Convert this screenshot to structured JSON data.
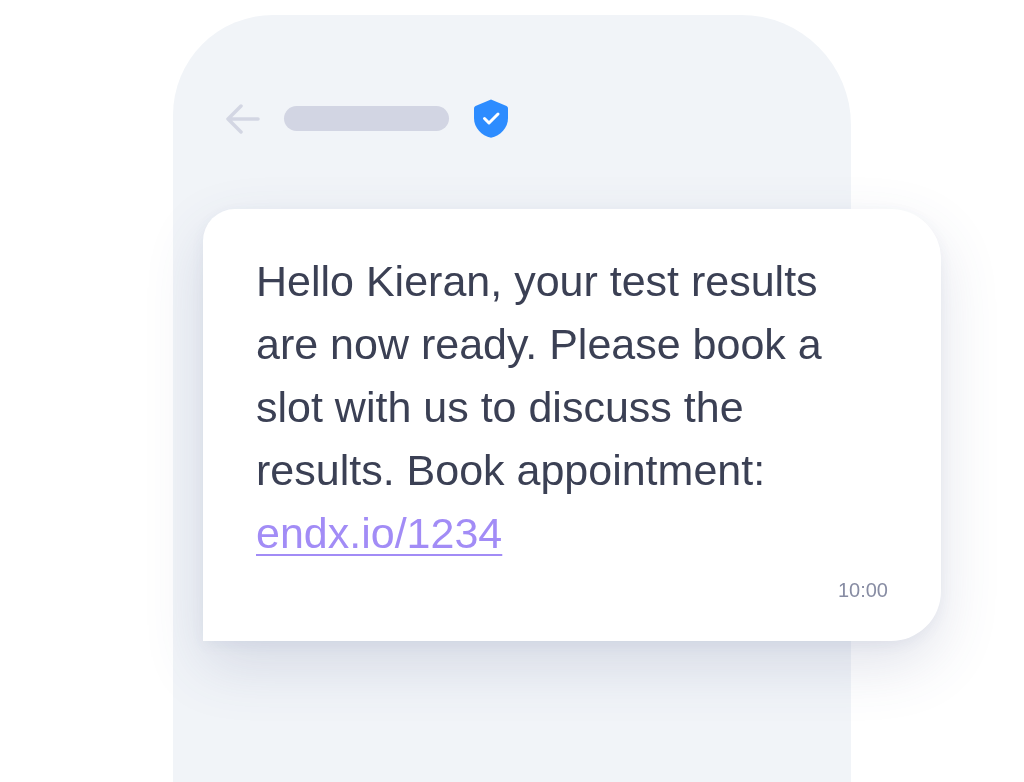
{
  "header": {
    "verified": true
  },
  "message": {
    "text": "Hello Kieran, your test results are now ready. Please book a slot with us to discuss the results. Book appointment:",
    "link": "endx.io/1234",
    "time": "10:00"
  }
}
